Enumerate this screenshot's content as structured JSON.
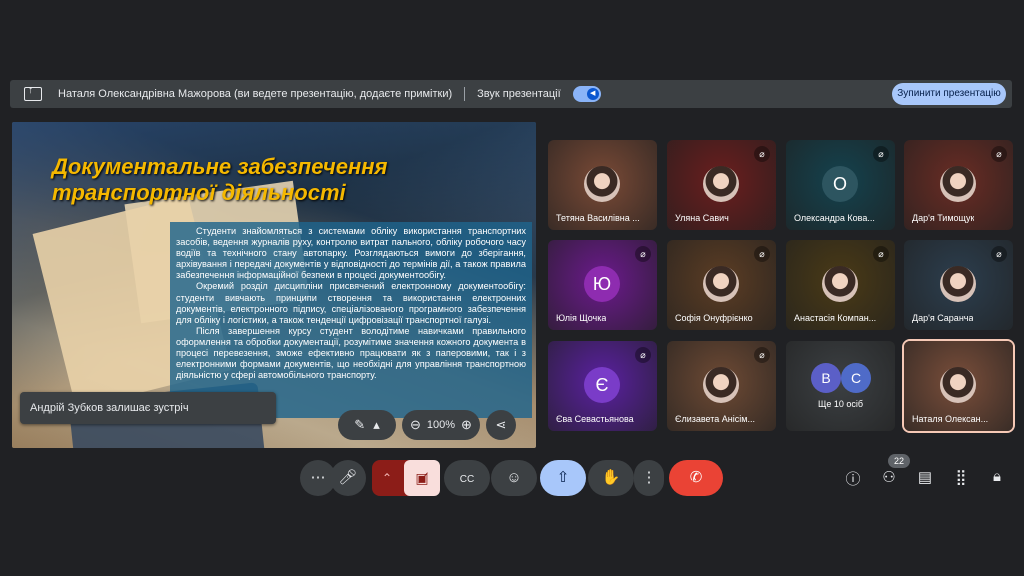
{
  "presentation_bar": {
    "presenter_text": "Наталя Олександрівна Мажорова (ви ведете презентацію, додаєте примітки)",
    "sound_label": "Звук презентації",
    "stop_button": "Зупинити презентацію"
  },
  "slide": {
    "title_line1": "Документальне забезпечення",
    "title_line2": "транспортної діяльності",
    "paragraphs": [
      "Студенти знайомляться з системами обліку використання транспортних засобів, ведення журналів руху, контролю витрат пального, обліку робочого часу водіїв та технічного стану автопарку. Розглядаються вимоги до зберігання, архівування і передачі документів у відповідності до термінів дії, а також правила забезпечення інформаційної безпеки в процесі документообігу.",
      "Окремий розділ дисципліни присвячений електронному документообігу: студенти вивчають принципи створення та використання електронних документів, електронного підпису, спеціалізованого програмного забезпечення для обліку і логістики, а також тенденції цифровізації транспортної галузі.",
      "Після завершення курсу студент володітиме навичками правильного оформлення та обробки документації, розумітиме значення кожного документа в процесі перевезення, зможе ефективно працювати як з паперовими, так і з електронними формами документів, що необхідні для управління транспортною діяльністю у сфері автомобільного транспорту."
    ],
    "zoom_level": "100%"
  },
  "toast": "Андрій Зубков залишає зустріч",
  "participants": [
    {
      "name": "Тетяна Василівна ...",
      "bg": "#7a4a36",
      "type": "photo",
      "muted": false
    },
    {
      "name": "Уляна Савич",
      "bg": "#6b1e1e",
      "type": "photo",
      "muted": true
    },
    {
      "name": "Олександра Кова...",
      "bg": "#14424e",
      "type": "letter",
      "letter": "О",
      "letter_bg": "#2d5560",
      "muted": true
    },
    {
      "name": "Дар'я Тимощук",
      "bg": "#6a2c24",
      "type": "photo",
      "muted": true
    },
    {
      "name": "Юлія Щочка",
      "bg": "#6b1a8c",
      "type": "letter",
      "letter": "Ю",
      "letter_bg": "#8e2cb0",
      "muted": true
    },
    {
      "name": "Софія Онуфрієнко",
      "bg": "#5c3d24",
      "type": "photo",
      "muted": true
    },
    {
      "name": "Анастасія Компан...",
      "bg": "#4a3a16",
      "type": "photo",
      "muted": true
    },
    {
      "name": "Дар'я Саранча",
      "bg": "#2c3e4e",
      "type": "photo",
      "muted": true
    },
    {
      "name": "Єва Севастьянова",
      "bg": "#5a20a0",
      "type": "letter",
      "letter": "Є",
      "letter_bg": "#7a3cc8",
      "muted": true
    },
    {
      "name": "Єлизавета Анісім...",
      "bg": "#6e4a34",
      "type": "photo",
      "muted": true
    },
    {
      "name": "Ще 10 осіб",
      "bg": "#3c4043",
      "type": "group",
      "letters": [
        "В",
        "С"
      ],
      "muted": false
    },
    {
      "name": "Наталя Олексан...",
      "bg": "#7a4e3a",
      "type": "photo",
      "muted": false,
      "selected": true
    }
  ],
  "participants_count": "22",
  "icons": {
    "more": "⋯",
    "mic": "🎙",
    "chevron_up": "⌃",
    "camera_off": "⛔",
    "captions": "CC",
    "emoji": "☺",
    "present": "⇧",
    "hand": "✋",
    "more_vert": "⋮",
    "end_call": "☎",
    "info": "ⓘ",
    "people": "👥",
    "chat": "💬",
    "apps": "⋮⋮",
    "lock": "🔒"
  }
}
